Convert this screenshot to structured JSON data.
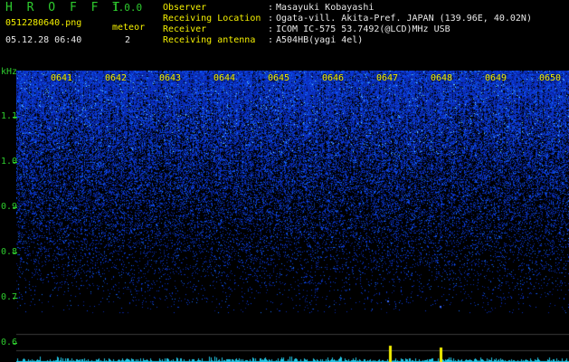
{
  "header": {
    "brand": "H R O F F T",
    "version": "1.0.0",
    "filename": "0512280640.png",
    "timestamp": "05.12.28 06:40",
    "meteor_label": "meteor",
    "meteor_count": "2"
  },
  "info": [
    {
      "label": "Observer",
      "value": "Masayuki Kobayashi"
    },
    {
      "label": "Receiving Location",
      "value": "Ogata-vill. Akita-Pref. JAPAN (139.96E, 40.02N)"
    },
    {
      "label": "Receiver",
      "value": "ICOM IC-575 53.7492(@LCD)MHz USB"
    },
    {
      "label": "Receiving antenna",
      "value": "A504HB(yagi 4el)"
    }
  ],
  "separator": ":",
  "y_axis": {
    "unit": "kHz",
    "ticks": [
      "1.1",
      "1.0",
      "0.9",
      "0.8",
      "0.7",
      "0.6"
    ]
  },
  "x_axis": {
    "ticks": [
      "0641",
      "0642",
      "0643",
      "0644",
      "0645",
      "0646",
      "0647",
      "0648",
      "0649",
      "0650"
    ]
  },
  "colors": {
    "label_green": "#2ecc2e",
    "text_white": "#e8e8e8",
    "marker_yellow": "#f4f000",
    "signal_blue": "#1a3cff",
    "signal_cyan": "#00e5ff"
  }
}
